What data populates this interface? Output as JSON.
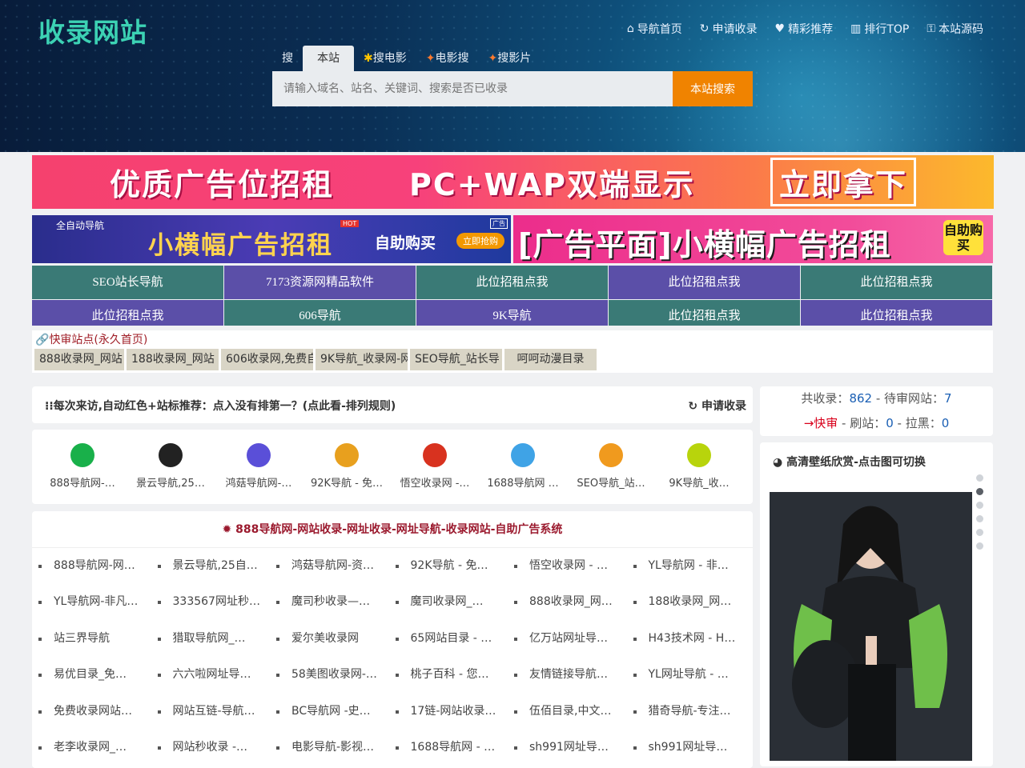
{
  "site": {
    "logo": "收录网站"
  },
  "nav": [
    {
      "icon": "home-icon",
      "glyph": "⌂",
      "label": "导航首页"
    },
    {
      "icon": "refresh-icon",
      "glyph": "↻",
      "label": "申请收录"
    },
    {
      "icon": "heart-icon",
      "glyph": "♥",
      "label": "精彩推荐"
    },
    {
      "icon": "bar-chart-icon",
      "glyph": "▥",
      "label": "排行TOP"
    },
    {
      "icon": "code-icon",
      "glyph": "⚿",
      "label": "本站源码"
    }
  ],
  "search": {
    "prefix": "搜",
    "tabs": [
      "本站",
      "搜电影",
      "电影搜",
      "搜影片"
    ],
    "placeholder": "请输入域名、站名、关键词、搜索是否已收录",
    "button": "本站搜索"
  },
  "banners": {
    "top": {
      "part1": "优质广告位招租",
      "part2": "PC+WAP双端显示",
      "part3": "立即拿下"
    },
    "left": {
      "tag": "全自动导航",
      "title": "小横幅广告招租",
      "hot": "HOT",
      "buy": "自助购买",
      "go": "立即抢购",
      "ad": "广告"
    },
    "right": {
      "title": "[广告平面]小横幅广告招租",
      "self": "自助购买"
    }
  },
  "grid_links": [
    "SEO站长导航",
    "7173资源网精品软件",
    "此位招租点我",
    "此位招租点我",
    "此位招租点我",
    "此位招租点我",
    "606导航",
    "9K导航",
    "此位招租点我",
    "此位招租点我"
  ],
  "quick": {
    "head": "快审站点(永久首页)",
    "items": [
      "888收录网_网站",
      "188收录网_网站",
      "606收录网,免费自",
      "9K导航_收录网-网",
      "SEO导航_站长导",
      "呵呵动漫目录"
    ]
  },
  "notice": {
    "text": "每次来访,自动红色+站标推荐：点入没有排第一？(点此看-排列规则)",
    "apply": "申请收录"
  },
  "stats": {
    "total_label": "共收录：",
    "total": "862",
    "pending_label": " - 待审网站：",
    "pending": "7",
    "fast": "→快审",
    "refresh_label": " - 刷站：",
    "refresh": "0",
    "black_label": " - 拉黑：",
    "black": "0"
  },
  "top8": [
    {
      "label": "888导航网-…",
      "color": "#19b04a"
    },
    {
      "label": "景云导航,25…",
      "color": "#222"
    },
    {
      "label": "鸿菇导航网-…",
      "color": "#5a4fd8"
    },
    {
      "label": "92K导航 - 免…",
      "color": "#e8a01e"
    },
    {
      "label": "悟空收录网 -…",
      "color": "#d8321f"
    },
    {
      "label": "1688导航网 …",
      "color": "#3fa3e6"
    },
    {
      "label": "SEO导航_站…",
      "color": "#f09a1e"
    },
    {
      "label": "9K导航_收…",
      "color": "#b8d40c"
    }
  ],
  "wallpaper": {
    "title": "高清壁纸欣赏-点击图可切换"
  },
  "list": {
    "title": "888导航网-网站收录-网址收录-网址导航-收录网站-自助广告系统",
    "items": [
      "888导航网-网…",
      "景云导航,25自…",
      "鸿菇导航网-资…",
      "92K导航 - 免…",
      "悟空收录网 - …",
      "YL导航网 - 非…",
      "YL导航网-非凡…",
      "333567网址秒…",
      "魔司秒收录—…",
      "魔司收录网_…",
      "888收录网_网…",
      "188收录网_网…",
      "站三界导航",
      "猎取导航网_…",
      "爱尔美收录网",
      "65网站目录 - …",
      "亿万站网址导…",
      "H43技术网 - H…",
      "易优目录_免…",
      "六六啦网址导…",
      "58美图收录网-…",
      "桃子百科 - 您…",
      "友情链接导航…",
      "YL网址导航 - …",
      "免费收录网站…",
      "网站互链-导航…",
      "BC导航网 -史…",
      "17链-网站收录…",
      "伍佰目录,中文…",
      "猎奇导航-专注…",
      "老李收录网_…",
      "网站秒收录 -…",
      "电影导航-影视…",
      "1688导航网 - …",
      "sh991网址导…",
      "sh991网址导…"
    ]
  },
  "colors": {
    "accent_orange": "#f08300",
    "teal": "#3a7a76",
    "purple": "#5b4fa8",
    "logo": "#3cd2b4"
  }
}
